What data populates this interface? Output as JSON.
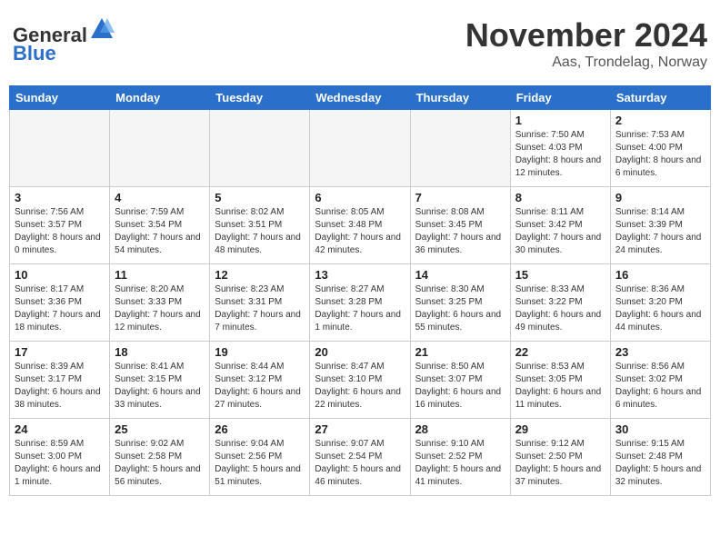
{
  "header": {
    "logo_general": "General",
    "logo_blue": "Blue",
    "month_title": "November 2024",
    "location": "Aas, Trondelag, Norway"
  },
  "days_of_week": [
    "Sunday",
    "Monday",
    "Tuesday",
    "Wednesday",
    "Thursday",
    "Friday",
    "Saturday"
  ],
  "weeks": [
    [
      {
        "day": "",
        "info": "",
        "empty": true
      },
      {
        "day": "",
        "info": "",
        "empty": true
      },
      {
        "day": "",
        "info": "",
        "empty": true
      },
      {
        "day": "",
        "info": "",
        "empty": true
      },
      {
        "day": "",
        "info": "",
        "empty": true
      },
      {
        "day": "1",
        "info": "Sunrise: 7:50 AM\nSunset: 4:03 PM\nDaylight: 8 hours and 12 minutes."
      },
      {
        "day": "2",
        "info": "Sunrise: 7:53 AM\nSunset: 4:00 PM\nDaylight: 8 hours and 6 minutes."
      }
    ],
    [
      {
        "day": "3",
        "info": "Sunrise: 7:56 AM\nSunset: 3:57 PM\nDaylight: 8 hours and 0 minutes."
      },
      {
        "day": "4",
        "info": "Sunrise: 7:59 AM\nSunset: 3:54 PM\nDaylight: 7 hours and 54 minutes."
      },
      {
        "day": "5",
        "info": "Sunrise: 8:02 AM\nSunset: 3:51 PM\nDaylight: 7 hours and 48 minutes."
      },
      {
        "day": "6",
        "info": "Sunrise: 8:05 AM\nSunset: 3:48 PM\nDaylight: 7 hours and 42 minutes."
      },
      {
        "day": "7",
        "info": "Sunrise: 8:08 AM\nSunset: 3:45 PM\nDaylight: 7 hours and 36 minutes."
      },
      {
        "day": "8",
        "info": "Sunrise: 8:11 AM\nSunset: 3:42 PM\nDaylight: 7 hours and 30 minutes."
      },
      {
        "day": "9",
        "info": "Sunrise: 8:14 AM\nSunset: 3:39 PM\nDaylight: 7 hours and 24 minutes."
      }
    ],
    [
      {
        "day": "10",
        "info": "Sunrise: 8:17 AM\nSunset: 3:36 PM\nDaylight: 7 hours and 18 minutes."
      },
      {
        "day": "11",
        "info": "Sunrise: 8:20 AM\nSunset: 3:33 PM\nDaylight: 7 hours and 12 minutes."
      },
      {
        "day": "12",
        "info": "Sunrise: 8:23 AM\nSunset: 3:31 PM\nDaylight: 7 hours and 7 minutes."
      },
      {
        "day": "13",
        "info": "Sunrise: 8:27 AM\nSunset: 3:28 PM\nDaylight: 7 hours and 1 minute."
      },
      {
        "day": "14",
        "info": "Sunrise: 8:30 AM\nSunset: 3:25 PM\nDaylight: 6 hours and 55 minutes."
      },
      {
        "day": "15",
        "info": "Sunrise: 8:33 AM\nSunset: 3:22 PM\nDaylight: 6 hours and 49 minutes."
      },
      {
        "day": "16",
        "info": "Sunrise: 8:36 AM\nSunset: 3:20 PM\nDaylight: 6 hours and 44 minutes."
      }
    ],
    [
      {
        "day": "17",
        "info": "Sunrise: 8:39 AM\nSunset: 3:17 PM\nDaylight: 6 hours and 38 minutes."
      },
      {
        "day": "18",
        "info": "Sunrise: 8:41 AM\nSunset: 3:15 PM\nDaylight: 6 hours and 33 minutes."
      },
      {
        "day": "19",
        "info": "Sunrise: 8:44 AM\nSunset: 3:12 PM\nDaylight: 6 hours and 27 minutes."
      },
      {
        "day": "20",
        "info": "Sunrise: 8:47 AM\nSunset: 3:10 PM\nDaylight: 6 hours and 22 minutes."
      },
      {
        "day": "21",
        "info": "Sunrise: 8:50 AM\nSunset: 3:07 PM\nDaylight: 6 hours and 16 minutes."
      },
      {
        "day": "22",
        "info": "Sunrise: 8:53 AM\nSunset: 3:05 PM\nDaylight: 6 hours and 11 minutes."
      },
      {
        "day": "23",
        "info": "Sunrise: 8:56 AM\nSunset: 3:02 PM\nDaylight: 6 hours and 6 minutes."
      }
    ],
    [
      {
        "day": "24",
        "info": "Sunrise: 8:59 AM\nSunset: 3:00 PM\nDaylight: 6 hours and 1 minute."
      },
      {
        "day": "25",
        "info": "Sunrise: 9:02 AM\nSunset: 2:58 PM\nDaylight: 5 hours and 56 minutes."
      },
      {
        "day": "26",
        "info": "Sunrise: 9:04 AM\nSunset: 2:56 PM\nDaylight: 5 hours and 51 minutes."
      },
      {
        "day": "27",
        "info": "Sunrise: 9:07 AM\nSunset: 2:54 PM\nDaylight: 5 hours and 46 minutes."
      },
      {
        "day": "28",
        "info": "Sunrise: 9:10 AM\nSunset: 2:52 PM\nDaylight: 5 hours and 41 minutes."
      },
      {
        "day": "29",
        "info": "Sunrise: 9:12 AM\nSunset: 2:50 PM\nDaylight: 5 hours and 37 minutes."
      },
      {
        "day": "30",
        "info": "Sunrise: 9:15 AM\nSunset: 2:48 PM\nDaylight: 5 hours and 32 minutes."
      }
    ]
  ]
}
